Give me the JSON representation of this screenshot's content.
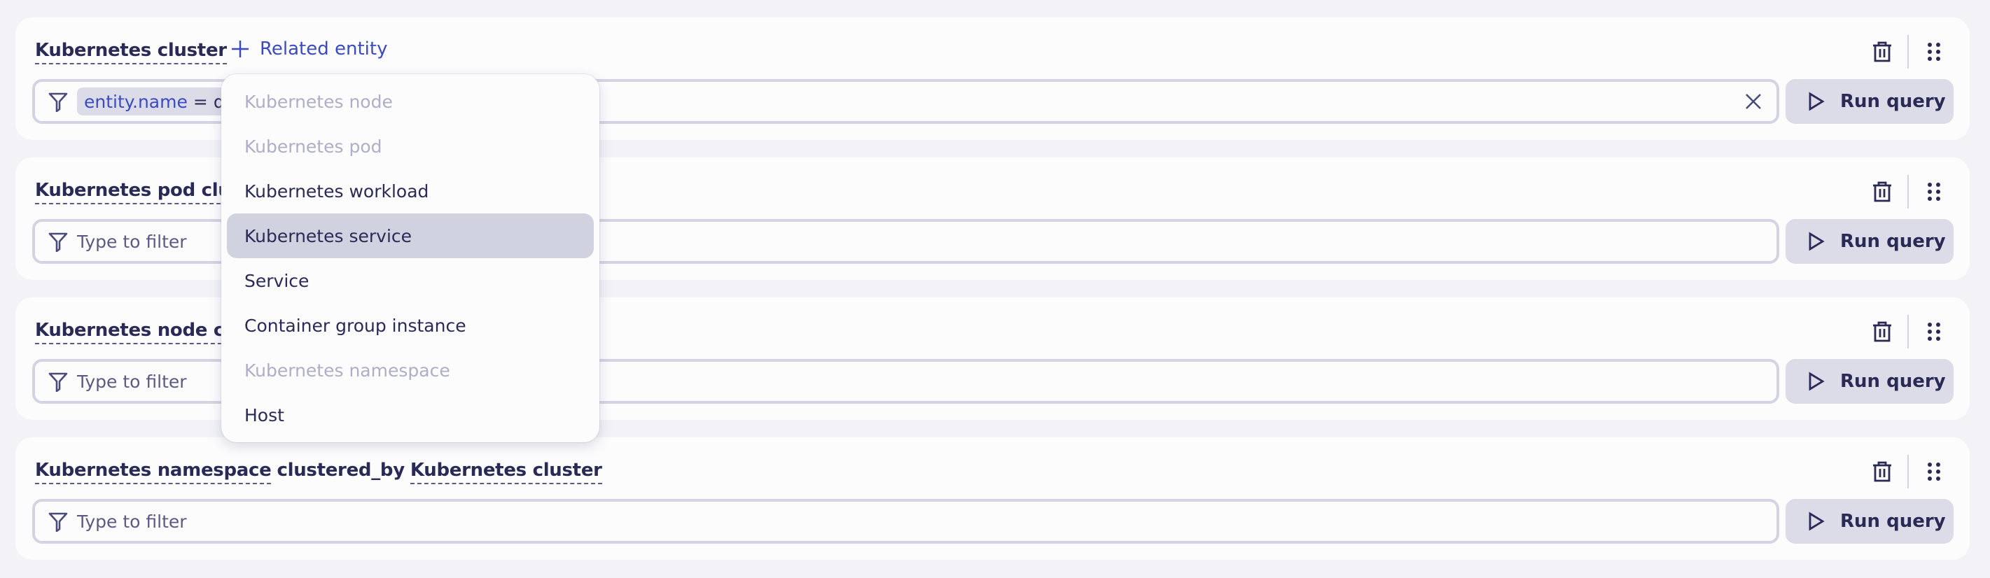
{
  "colors": {
    "background": "#f2f2f7",
    "card": "#fcfcfd",
    "text_primary": "#2a2a57",
    "accent_blue": "#3b4bbf",
    "disabled_text": "#aeaec6",
    "highlight": "#d1d2e0",
    "button_bg": "#dcdce8"
  },
  "related_entity_button": {
    "label": "Related entity",
    "icon": "plus-icon"
  },
  "cards": [
    {
      "title_parts": [
        "Kubernetes cluster"
      ],
      "filter": {
        "chip": {
          "key": "entity.name",
          "operator": "=",
          "value": "dt"
        },
        "placeholder": "",
        "clear_icon": "close-icon"
      },
      "run_label": "Run query"
    },
    {
      "title_parts": [
        "Kubernetes pod clus"
      ],
      "filter": {
        "placeholder": "Type to filter"
      },
      "run_label": "Run query"
    },
    {
      "title_parts": [
        "Kubernetes node clu"
      ],
      "filter": {
        "placeholder": "Type to filter"
      },
      "run_label": "Run query"
    },
    {
      "title_parts": [
        "Kubernetes namespace",
        "clustered_by",
        "Kubernetes cluster"
      ],
      "filter": {
        "placeholder": "Type to filter"
      },
      "run_label": "Run query"
    }
  ],
  "icons": {
    "filter": "filter-icon",
    "run": "play-icon",
    "delete": "trash-icon",
    "drag": "drag-handle-icon"
  },
  "dropdown": {
    "items": [
      {
        "label": "Kubernetes node",
        "state": "disabled"
      },
      {
        "label": "Kubernetes pod",
        "state": "disabled"
      },
      {
        "label": "Kubernetes workload",
        "state": "enabled"
      },
      {
        "label": "Kubernetes service",
        "state": "highlighted"
      },
      {
        "label": "Service",
        "state": "enabled"
      },
      {
        "label": "Container group instance",
        "state": "enabled"
      },
      {
        "label": "Kubernetes namespace",
        "state": "disabled"
      },
      {
        "label": "Host",
        "state": "enabled"
      }
    ]
  }
}
